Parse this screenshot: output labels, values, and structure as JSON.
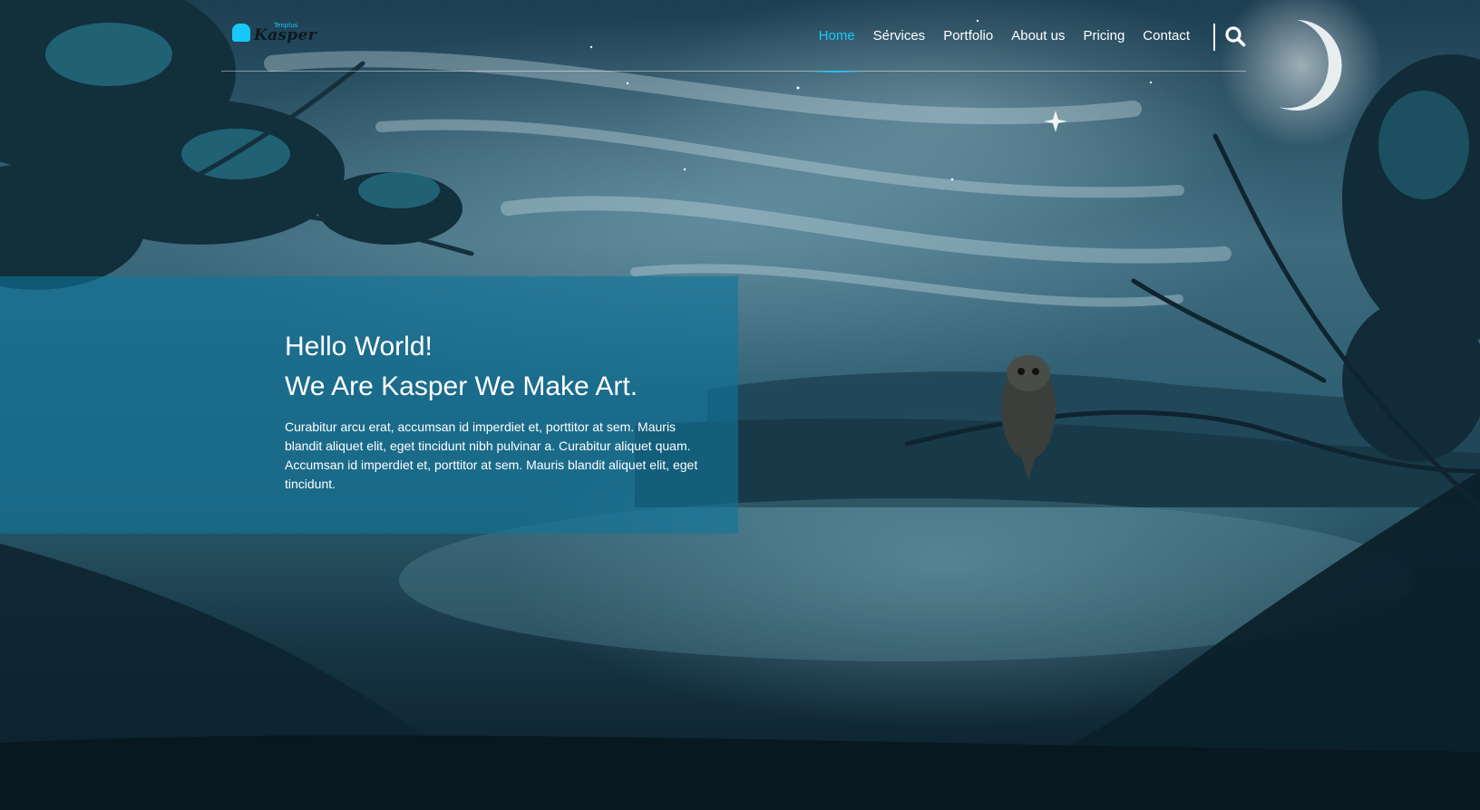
{
  "logo": {
    "small_text": "Tenplus",
    "name": "Kasper",
    "icon": "kasper-logo-icon"
  },
  "nav": {
    "items": [
      {
        "label": "Home",
        "active": true
      },
      {
        "label": "Services",
        "active": false
      },
      {
        "label": "Portfolio",
        "active": false
      },
      {
        "label": "About us",
        "active": false
      },
      {
        "label": "Pricing",
        "active": false
      },
      {
        "label": "Contact",
        "active": false
      }
    ],
    "search_icon": "search-icon"
  },
  "hero": {
    "title_line1": "Hello World!",
    "title_line2": "We Are Kasper We Make Art.",
    "description": "Curabitur arcu erat, accumsan id imperdiet et, porttitor at sem. Mauris blandit aliquet elit, eget tincidunt nibh pulvinar a. Curabitur aliquet quam. Accumsan id imperdiet et, porttitor at sem. Mauris blandit aliquet elit, eget tincidunt."
  },
  "colors": {
    "accent": "#19c8fa",
    "hero_box": "rgba(15,117,155,0.62)",
    "text": "#ffffff"
  }
}
